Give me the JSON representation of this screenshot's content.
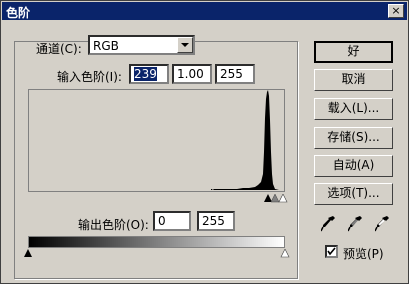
{
  "window": {
    "title": "色阶",
    "close_glyph": "×"
  },
  "channel": {
    "label": "通道(C):",
    "value": "RGB"
  },
  "input_levels": {
    "label": "输入色阶(I):",
    "black": "239",
    "gamma": "1.00",
    "white": "255"
  },
  "output_levels": {
    "label": "输出色阶(O):",
    "black": "0",
    "white": "255"
  },
  "histogram": {
    "peak_level": 239,
    "range": [
      0,
      255
    ]
  },
  "buttons": {
    "ok": "好",
    "cancel": "取消",
    "load": "载入(L)...",
    "save": "存储(S)...",
    "auto": "自动(A)",
    "options": "选项(T)..."
  },
  "preview": {
    "label": "预览(P)",
    "checked": true
  },
  "colors": {
    "titlebar": "#0a246a",
    "face": "#d4d0c8"
  }
}
